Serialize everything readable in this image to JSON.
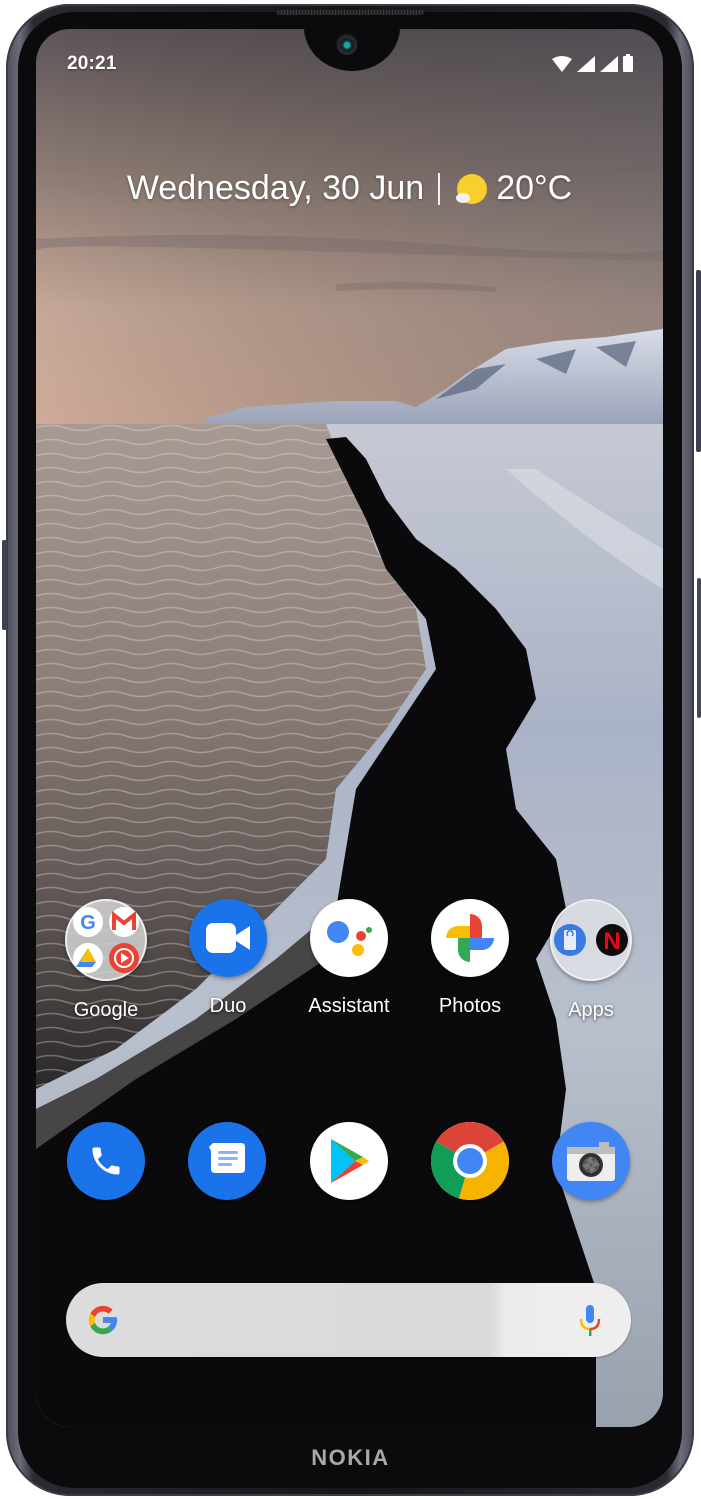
{
  "device": {
    "brand": "NOKIA"
  },
  "status_bar": {
    "time": "20:21",
    "icons": [
      "wifi-icon",
      "signal-icon",
      "signal-icon",
      "battery-icon"
    ]
  },
  "at_a_glance": {
    "date": "Wednesday, 30 Jun",
    "weather_icon": "sunny-partly-cloudy-icon",
    "temperature": "20°C"
  },
  "home_apps": [
    {
      "label": "Google",
      "icon": "google-folder-icon",
      "type": "folder",
      "contents": [
        "Google",
        "Gmail",
        "Drive",
        "YouTube Music"
      ]
    },
    {
      "label": "Duo",
      "icon": "duo-video-icon"
    },
    {
      "label": "Assistant",
      "icon": "assistant-icon"
    },
    {
      "label": "Photos",
      "icon": "photos-pinwheel-icon"
    },
    {
      "label": "Apps",
      "icon": "apps-folder-icon",
      "type": "folder",
      "contents": [
        "Support",
        "Netflix"
      ]
    }
  ],
  "dock": [
    {
      "name": "Phone",
      "icon": "phone-icon"
    },
    {
      "name": "Messages",
      "icon": "messages-icon"
    },
    {
      "name": "Play Store",
      "icon": "play-store-icon"
    },
    {
      "name": "Chrome",
      "icon": "chrome-icon"
    },
    {
      "name": "Camera",
      "icon": "camera-icon"
    }
  ],
  "search": {
    "placeholder": "",
    "left_icon": "google-g-icon",
    "right_icon": "microphone-icon"
  },
  "colors": {
    "google_blue": "#4285F4",
    "google_red": "#EA4335",
    "google_yellow": "#FBBC04",
    "google_green": "#34A853",
    "duo_blue": "#1A73E8",
    "netflix_red": "#E50914"
  }
}
